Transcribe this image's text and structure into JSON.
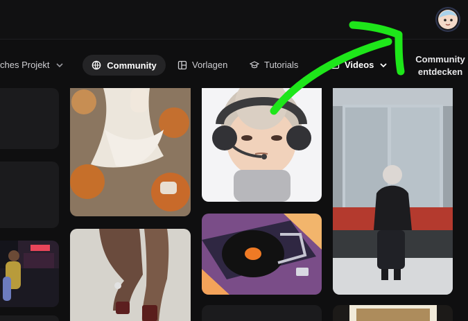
{
  "nav": {
    "project_label": "ches Projekt",
    "community_label": "Community",
    "templates_label": "Vorlagen",
    "tutorials_label": "Tutorials",
    "videos_label": "Videos",
    "community_cta_line1": "Community",
    "community_cta_line2": "entdecken"
  },
  "icons": {
    "globe": "globe-icon",
    "templates": "layout-icon",
    "tutorials": "graduation-cap-icon",
    "videos": "play-icon",
    "chevron": "chevron-down-icon",
    "avatar": "avatar"
  },
  "colors": {
    "background": "#0f0f10",
    "active_pill": "#242426",
    "arrow": "#1ee61a"
  },
  "gallery": {
    "columns": 5
  }
}
